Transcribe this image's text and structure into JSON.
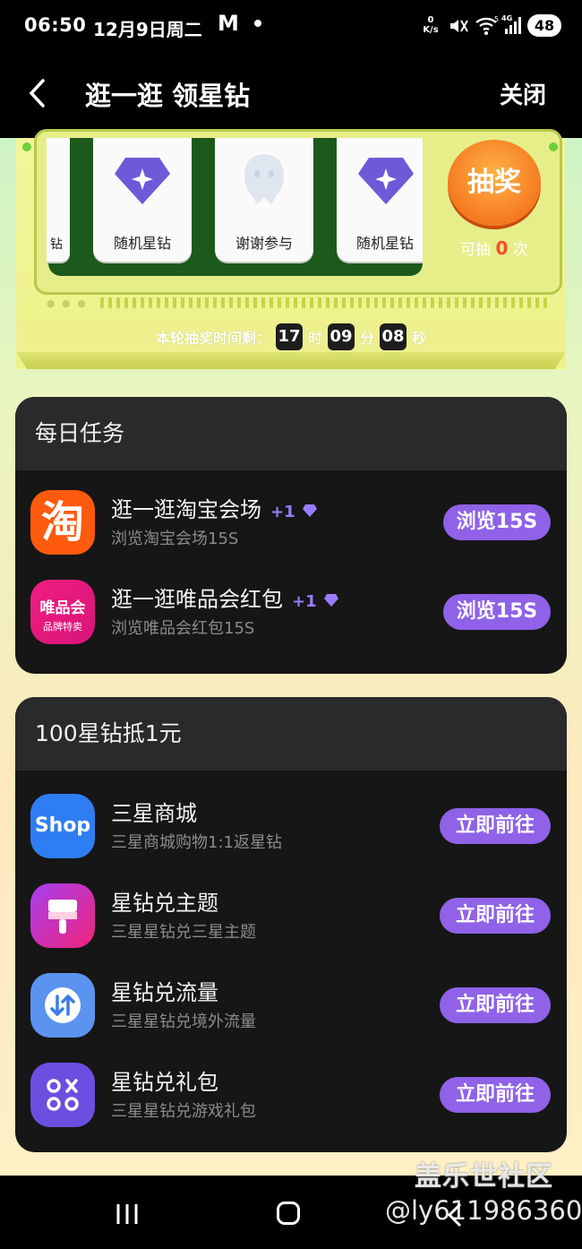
{
  "status": {
    "time": "06:50",
    "date": "12月9日周二",
    "app_glyph": "M",
    "net_rate": "0",
    "net_unit": "K/s",
    "wifi_tag": "5",
    "cell_tag": "4G",
    "battery": "48"
  },
  "header": {
    "title": "逛一逛 领星钻",
    "close": "关闭"
  },
  "lottery": {
    "prizes": [
      "随机星钻",
      "谢谢参与",
      "随机星钻"
    ],
    "left_partial": "钻",
    "draw_button": "抽奖",
    "draw_prefix": "可抽",
    "draw_count": "0",
    "draw_suffix": "次",
    "timer_label": "本轮抽奖时间剩：",
    "hours": "17",
    "h_unit": "时",
    "minutes": "09",
    "m_unit": "分",
    "seconds": "08",
    "s_unit": "秒"
  },
  "daily": {
    "title": "每日任务",
    "tasks": [
      {
        "title": "逛一逛淘宝会场",
        "reward": "+1",
        "subtitle": "浏览淘宝会场15S",
        "button": "浏览15S",
        "icon": "taobao-icon",
        "icon_text": "淘"
      },
      {
        "title": "逛一逛唯品会红包",
        "reward": "+1",
        "subtitle": "浏览唯品会红包15S",
        "button": "浏览15S",
        "icon": "vipshop-icon",
        "icon_text1": "唯品会",
        "icon_text2": "品牌特卖"
      }
    ]
  },
  "redeem": {
    "title": "100星钻抵1元",
    "items": [
      {
        "title": "三星商城",
        "subtitle": "三星商城购物1:1返星钻",
        "button": "立即前往",
        "icon": "samsung-shop-icon",
        "icon_text": "Shop"
      },
      {
        "title": "星钻兑主题",
        "subtitle": "三星星钻兑三星主题",
        "button": "立即前往",
        "icon": "theme-brush-icon"
      },
      {
        "title": "星钻兑流量",
        "subtitle": "三星星钻兑境外流量",
        "button": "立即前往",
        "icon": "data-exchange-icon"
      },
      {
        "title": "星钻兑礼包",
        "subtitle": "三星星钻兑游戏礼包",
        "button": "立即前往",
        "icon": "game-pack-icon"
      }
    ]
  },
  "watermark": {
    "site": "盖乐世社区",
    "user": "@ly611986360"
  },
  "colors": {
    "accent": "#8f62e8",
    "card": "#161616",
    "card_header": "#2a2a2c",
    "draw_orange": "#f57a1f"
  }
}
